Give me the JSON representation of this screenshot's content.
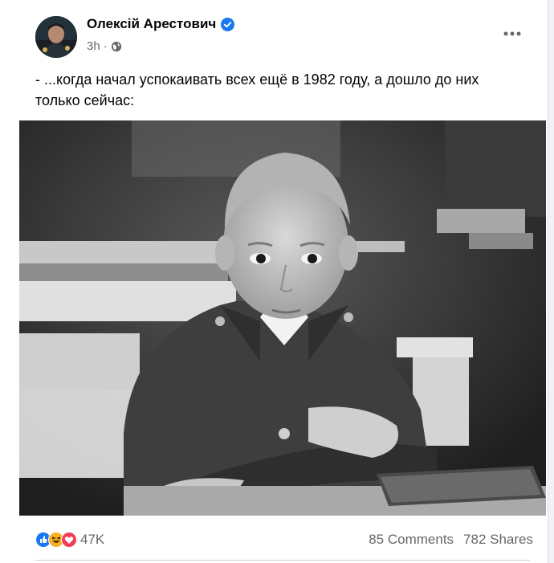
{
  "post": {
    "author": "Олексій Арестович",
    "time": "3h",
    "caption_line1": "- ...когда начал успокаивать всех ещё в 1982 году, а дошло до них",
    "caption_line2": "только сейчас:",
    "reaction_count": "47K",
    "comments": "85 Comments",
    "shares": "782 Shares"
  },
  "colors": {
    "verified": "#1877f2",
    "like": "#1877f2",
    "haha": "#f7b125",
    "love": "#f33e58",
    "secondary_text": "#65676b"
  },
  "icons": {
    "verified": "verified-badge-icon",
    "privacy": "globe-icon",
    "more": "more-options-icon",
    "like": "like-reaction-icon",
    "haha": "haha-reaction-icon",
    "love": "love-reaction-icon"
  }
}
